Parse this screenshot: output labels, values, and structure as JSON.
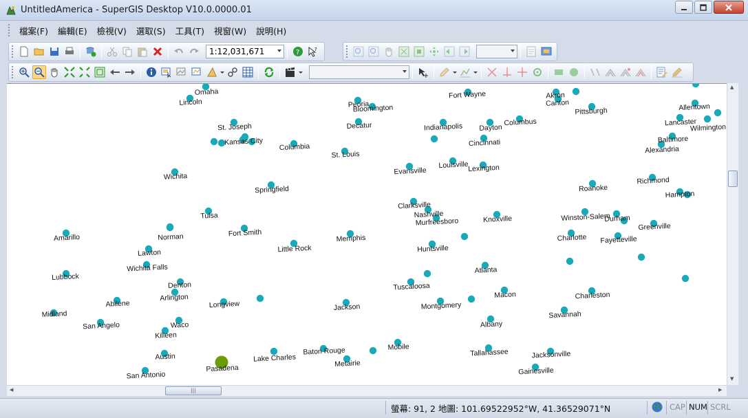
{
  "window": {
    "title": "UntitledAmerica - SuperGIS Desktop V10.0.0000.01"
  },
  "menu": [
    "檔案(F)",
    "編輯(E)",
    "檢視(V)",
    "選取(S)",
    "工具(T)",
    "視窗(W)",
    "說明(H)"
  ],
  "toolbar": {
    "scale": "1:12,031,671",
    "layer_combo": "",
    "zoom_combo": ""
  },
  "map": {
    "point_color": "#1aa9b9",
    "highlight_color": "#6b9c0c",
    "cities": [
      {
        "name": "Omaha"
      },
      {
        "name": "Lincoln"
      },
      {
        "name": "Peoria"
      },
      {
        "name": "Bloomington"
      },
      {
        "name": "Fort Wayne"
      },
      {
        "name": "Akron"
      },
      {
        "name": "Canton"
      },
      {
        "name": "Pittsburgh"
      },
      {
        "name": "Allentown"
      },
      {
        "name": "St. Joseph"
      },
      {
        "name": "Kansas City"
      },
      {
        "name": "Decatur"
      },
      {
        "name": "Indianapolis"
      },
      {
        "name": "Dayton"
      },
      {
        "name": "Columbus"
      },
      {
        "name": "Lancaster"
      },
      {
        "name": "Wilmington"
      },
      {
        "name": "Columbia"
      },
      {
        "name": "Cincinnati"
      },
      {
        "name": "Baltimore"
      },
      {
        "name": "Alexandria"
      },
      {
        "name": "St. Louis"
      },
      {
        "name": "Louisville"
      },
      {
        "name": "Evansville"
      },
      {
        "name": "Lexington"
      },
      {
        "name": "Wichita"
      },
      {
        "name": "Springfield"
      },
      {
        "name": "Roanoke"
      },
      {
        "name": "Richmond"
      },
      {
        "name": "Hampton"
      },
      {
        "name": "Clarksville"
      },
      {
        "name": "Tulsa"
      },
      {
        "name": "Nashville"
      },
      {
        "name": "Murfreesboro"
      },
      {
        "name": "Knoxville"
      },
      {
        "name": "Winston-Salem"
      },
      {
        "name": "Durham"
      },
      {
        "name": "Fort Smith"
      },
      {
        "name": "Amarillo"
      },
      {
        "name": "Norman"
      },
      {
        "name": "Greenville"
      },
      {
        "name": "Memphis"
      },
      {
        "name": "Charlotte"
      },
      {
        "name": "Fayetteville"
      },
      {
        "name": "Little Rock"
      },
      {
        "name": "Huntsville"
      },
      {
        "name": "Lawton"
      },
      {
        "name": "Wichita Falls"
      },
      {
        "name": "Atlanta"
      },
      {
        "name": "Lubbock"
      },
      {
        "name": "Denton"
      },
      {
        "name": "Tuscaloosa"
      },
      {
        "name": "Arlington"
      },
      {
        "name": "Macon"
      },
      {
        "name": "Charleston"
      },
      {
        "name": "Abilene"
      },
      {
        "name": "Longview"
      },
      {
        "name": "Jackson"
      },
      {
        "name": "Montgomery"
      },
      {
        "name": "Midland"
      },
      {
        "name": "Savannah"
      },
      {
        "name": "Waco"
      },
      {
        "name": "Albany"
      },
      {
        "name": "San Angelo"
      },
      {
        "name": "Killeen"
      },
      {
        "name": "Mobile"
      },
      {
        "name": "Baton Rouge"
      },
      {
        "name": "Tallahassee"
      },
      {
        "name": "Austin"
      },
      {
        "name": "Lake Charles"
      },
      {
        "name": "Jacksonville"
      },
      {
        "name": "Metairie"
      },
      {
        "name": "Pasadena"
      },
      {
        "name": "San Antonio"
      },
      {
        "name": "Gainesville"
      }
    ]
  },
  "status": {
    "coords": "螢幕: 91, 2  地圖: 101.69522952°W, 41.36529071°N",
    "cap": "CAP",
    "num": "NUM",
    "scrl": "SCRL"
  }
}
